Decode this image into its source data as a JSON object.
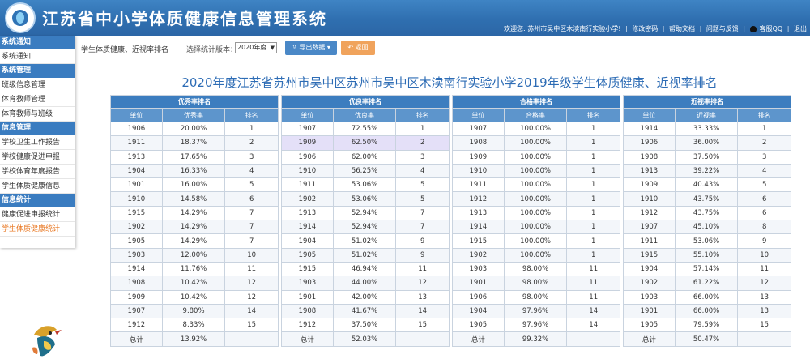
{
  "app": {
    "title": "江苏省中小学体质健康信息管理系统"
  },
  "userbar": {
    "welcome": "欢迎您: 苏州市吴中区木渎南行实验小学!",
    "change_password": "修改密码",
    "help_docs": "帮助文档",
    "feedback": "问题与反馈",
    "qq": "客服QQ",
    "logout": "退出"
  },
  "sidebar": {
    "sections": [
      {
        "title": "系统通知",
        "items": [
          "系统通知"
        ]
      },
      {
        "title": "系统管理",
        "items": [
          "班级信息管理",
          "体育教师管理",
          "体育教师与班级"
        ]
      },
      {
        "title": "信息管理",
        "items": [
          "学校卫生工作报告",
          "学校健康促进申报",
          "学校体育年度报告",
          "学生体质健康信息"
        ]
      },
      {
        "title": "信息统计",
        "items": [
          "健康促进申报统计",
          "学生体质健康统计"
        ]
      }
    ],
    "active_item": "学生体质健康统计"
  },
  "toolbar": {
    "title": "学生体质健康、近视率排名",
    "version_label": "选择统计版本：",
    "version_value": "2020年度",
    "export_label": "导出数据",
    "back_label": "返回"
  },
  "page_title": "2020年度江苏省苏州市吴中区苏州市吴中区木渎南行实验小学2019年级学生体质健康、近视率排名",
  "tables": [
    {
      "caption": "优秀率排名",
      "headers": [
        "单位",
        "优秀率",
        "排名"
      ],
      "rows": [
        [
          "1906",
          "20.00%",
          "1"
        ],
        [
          "1911",
          "18.37%",
          "2"
        ],
        [
          "1913",
          "17.65%",
          "3"
        ],
        [
          "1904",
          "16.33%",
          "4"
        ],
        [
          "1901",
          "16.00%",
          "5"
        ],
        [
          "1910",
          "14.58%",
          "6"
        ],
        [
          "1915",
          "14.29%",
          "7"
        ],
        [
          "1902",
          "14.29%",
          "7"
        ],
        [
          "1905",
          "14.29%",
          "7"
        ],
        [
          "1903",
          "12.00%",
          "10"
        ],
        [
          "1914",
          "11.76%",
          "11"
        ],
        [
          "1908",
          "10.42%",
          "12"
        ],
        [
          "1909",
          "10.42%",
          "12"
        ],
        [
          "1907",
          "9.80%",
          "14"
        ],
        [
          "1912",
          "8.33%",
          "15"
        ]
      ],
      "total": [
        "总计",
        "13.92%",
        ""
      ]
    },
    {
      "caption": "优良率排名",
      "headers": [
        "单位",
        "优良率",
        "排名"
      ],
      "rows": [
        [
          "1907",
          "72.55%",
          "1"
        ],
        [
          "1909",
          "62.50%",
          "2"
        ],
        [
          "1906",
          "62.00%",
          "3"
        ],
        [
          "1910",
          "56.25%",
          "4"
        ],
        [
          "1911",
          "53.06%",
          "5"
        ],
        [
          "1902",
          "53.06%",
          "5"
        ],
        [
          "1913",
          "52.94%",
          "7"
        ],
        [
          "1914",
          "52.94%",
          "7"
        ],
        [
          "1904",
          "51.02%",
          "9"
        ],
        [
          "1905",
          "51.02%",
          "9"
        ],
        [
          "1915",
          "46.94%",
          "11"
        ],
        [
          "1903",
          "44.00%",
          "12"
        ],
        [
          "1901",
          "42.00%",
          "13"
        ],
        [
          "1908",
          "41.67%",
          "14"
        ],
        [
          "1912",
          "37.50%",
          "15"
        ]
      ],
      "total": [
        "总计",
        "52.03%",
        ""
      ]
    },
    {
      "caption": "合格率排名",
      "headers": [
        "单位",
        "合格率",
        "排名"
      ],
      "rows": [
        [
          "1907",
          "100.00%",
          "1"
        ],
        [
          "1908",
          "100.00%",
          "1"
        ],
        [
          "1909",
          "100.00%",
          "1"
        ],
        [
          "1910",
          "100.00%",
          "1"
        ],
        [
          "1911",
          "100.00%",
          "1"
        ],
        [
          "1912",
          "100.00%",
          "1"
        ],
        [
          "1913",
          "100.00%",
          "1"
        ],
        [
          "1914",
          "100.00%",
          "1"
        ],
        [
          "1915",
          "100.00%",
          "1"
        ],
        [
          "1902",
          "100.00%",
          "1"
        ],
        [
          "1903",
          "98.00%",
          "11"
        ],
        [
          "1901",
          "98.00%",
          "11"
        ],
        [
          "1906",
          "98.00%",
          "11"
        ],
        [
          "1904",
          "97.96%",
          "14"
        ],
        [
          "1905",
          "97.96%",
          "14"
        ]
      ],
      "total": [
        "总计",
        "99.32%",
        ""
      ]
    },
    {
      "caption": "近视率排名",
      "headers": [
        "单位",
        "近视率",
        "排名"
      ],
      "rows": [
        [
          "1914",
          "33.33%",
          "1"
        ],
        [
          "1906",
          "36.00%",
          "2"
        ],
        [
          "1908",
          "37.50%",
          "3"
        ],
        [
          "1913",
          "39.22%",
          "4"
        ],
        [
          "1909",
          "40.43%",
          "5"
        ],
        [
          "1910",
          "43.75%",
          "6"
        ],
        [
          "1912",
          "43.75%",
          "6"
        ],
        [
          "1907",
          "45.10%",
          "8"
        ],
        [
          "1911",
          "53.06%",
          "9"
        ],
        [
          "1915",
          "55.10%",
          "10"
        ],
        [
          "1904",
          "57.14%",
          "11"
        ],
        [
          "1902",
          "61.22%",
          "12"
        ],
        [
          "1903",
          "66.00%",
          "13"
        ],
        [
          "1901",
          "66.00%",
          "13"
        ],
        [
          "1905",
          "79.59%",
          "15"
        ]
      ],
      "total": [
        "总计",
        "50.47%",
        ""
      ]
    }
  ],
  "highlighted": {
    "table": 1,
    "row": 1
  }
}
